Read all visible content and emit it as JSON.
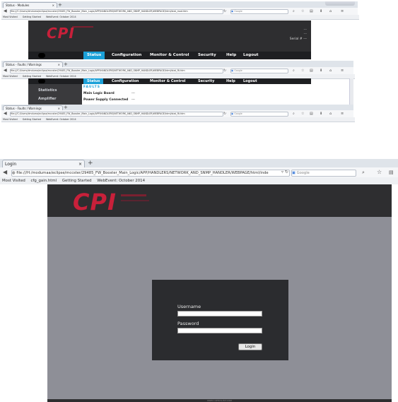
{
  "win1": {
    "tab_title": "Status - Modules",
    "url": "file:///C:/Users/dmduma/eclipse/mccster/29485_FW_Booster_Main_Logic/APP/HANDLERS/NETWORK_AND_SNMP_HANDLER/WEBPAGE/html/stat_mod.htm",
    "search_placeholder": "Google",
    "bookmarks": [
      "Most Visited",
      "Getting Started",
      "WebEvent: October 2014"
    ],
    "header_right": [
      "---",
      "---"
    ],
    "serial_label": "Serial # ---",
    "menu": [
      "Status",
      "Configuration",
      "Monitor & Control",
      "Security",
      "Help",
      "Logout"
    ]
  },
  "win2": {
    "tab_title": "Status - Faults / Warnings",
    "url": "file:///C:/Users/dmduma/eclipse/mccster/29485_FW_Booster_Main_Logic/APP/HANDLERS/NETWORK_AND_SNMP_HANDLER/WEBPAGE/html/stat_flt.htm",
    "search_placeholder": "Google",
    "bookmarks": [
      "Most Visited",
      "Getting Started",
      "WebEvent: October 2014"
    ],
    "menu": [
      "Status",
      "Configuration",
      "Monitor & Control",
      "Security",
      "Help",
      "Logout"
    ],
    "sidebar": [
      "Statistics",
      "Amplifier"
    ],
    "section_title": "FAULTS",
    "rows": [
      {
        "label": "Main Logic Board",
        "value": "---"
      },
      {
        "label": "Power Supply Connected",
        "value": "---"
      }
    ]
  },
  "win3": {
    "tab_title": "Status - Faults / Warnings",
    "url": "file:///C:/Users/dmduma/eclipse/mccster/29485_FW_Booster_Main_Logic/APP/HANDLERS/NETWORK_AND_SNMP_HANDLER/WEBPAGE/html/stat_flt.htm",
    "search_placeholder": "Google",
    "bookmarks": [
      "Most Visited",
      "Getting Started",
      "WebEvent: October 2014"
    ]
  },
  "win4": {
    "tab_title": "Login",
    "url": "file:///H:/modumaa/eclipse/mccster/29485_FW_Booster_Main_Logic/APP/HANDLERS/NETWORK_AND_SNMP_HANDLER/WEBPAGE/html/inde",
    "search_placeholder": "Google",
    "bookmarks": [
      "Most Visited",
      "cfg_gain.html",
      "Getting Started",
      "WebEvent: October 2014"
    ],
    "username_label": "Username",
    "password_label": "Password",
    "login_button": "Login",
    "footer": "DIREX OPTICS-ELT.COM"
  },
  "logo_text": "CPI",
  "colors": {
    "accent": "#1aa0d8",
    "logo_red": "#c8203a",
    "header_dark": "#2e2e30",
    "login_bg": "#8e8f97"
  },
  "icons": [
    "back-icon",
    "reload-icon",
    "search-icon",
    "star-icon",
    "clipboard-icon",
    "download-icon",
    "home-icon",
    "menu-icon",
    "globe-icon",
    "folder-icon"
  ]
}
